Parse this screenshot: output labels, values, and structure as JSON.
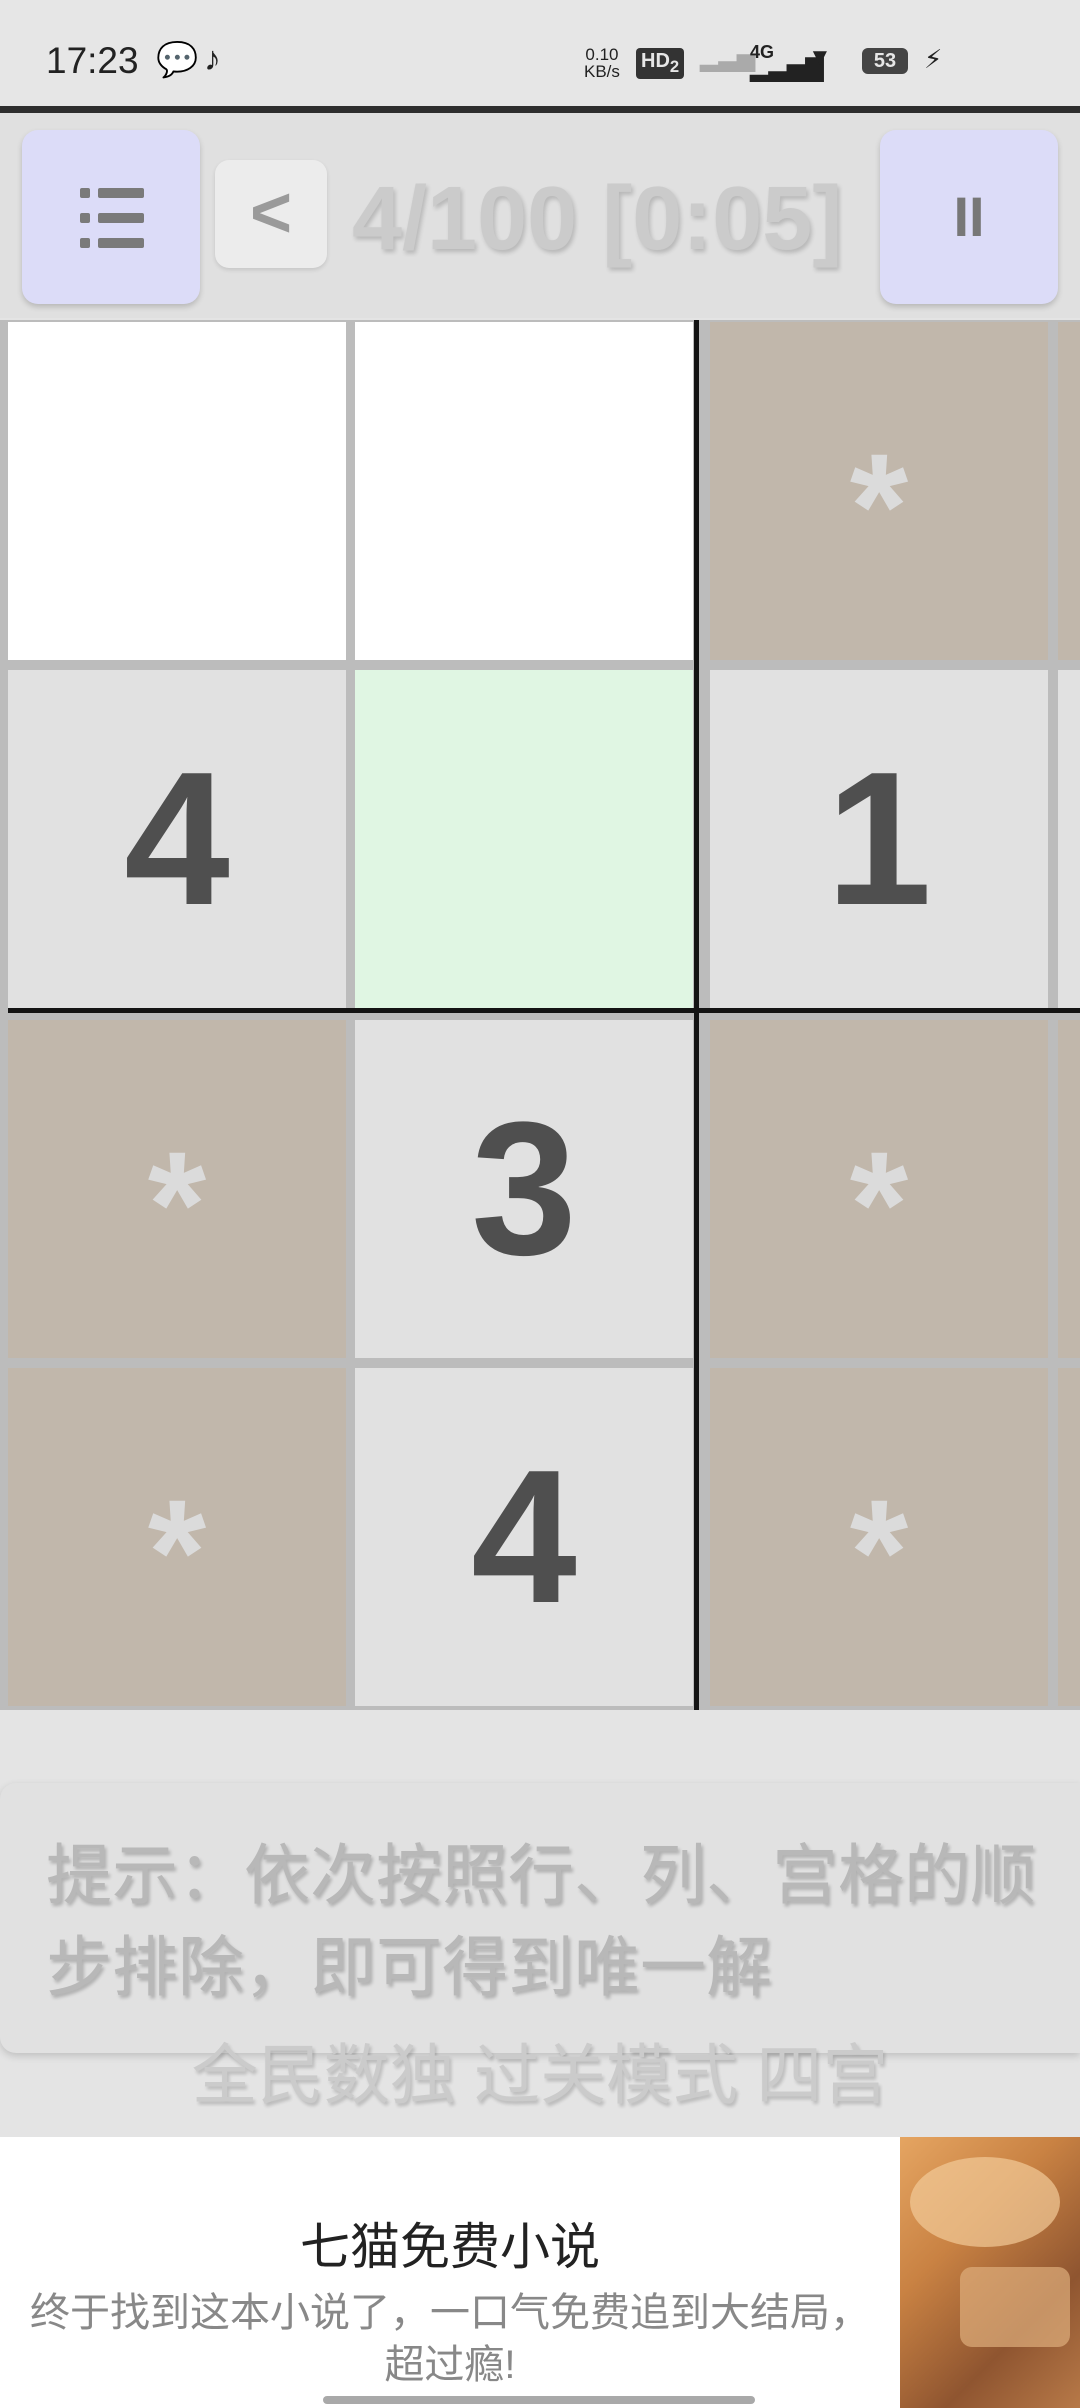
{
  "status_bar": {
    "time": "17:23",
    "net_speed_value": "0.10",
    "net_speed_unit": "KB/s",
    "hd_label": "HD",
    "hd_sub": "2",
    "network_type": "4G",
    "battery": "53"
  },
  "toolbar": {
    "back_label": "<",
    "level_display": "4/100 [0:05]",
    "pause_label": "II"
  },
  "board": {
    "rows": [
      [
        {
          "value": "",
          "style": "white"
        },
        {
          "value": "",
          "style": "white"
        },
        {
          "value": "*",
          "style": "tan"
        }
      ],
      [
        {
          "value": "4",
          "style": "gray"
        },
        {
          "value": "",
          "style": "green"
        },
        {
          "value": "1",
          "style": "gray"
        }
      ],
      [
        {
          "value": "*",
          "style": "tan"
        },
        {
          "value": "3",
          "style": "gray"
        },
        {
          "value": "*",
          "style": "tan"
        }
      ],
      [
        {
          "value": "*",
          "style": "tan"
        },
        {
          "value": "4",
          "style": "gray"
        },
        {
          "value": "*",
          "style": "tan"
        }
      ]
    ]
  },
  "hint": {
    "text": "提示：依次按照行、列、宫格的顺\n步排除，即可得到唯一解"
  },
  "mode_label": "全民数独 过关模式 四宫",
  "ad": {
    "title": "七猫免费小说",
    "description": "终于找到这本小说了，一口气免费追到大结局，超过瘾!"
  },
  "colors": {
    "given_cell": "#e1e1e1",
    "empty_cell": "#ffffff",
    "selected_cell": "#e0f6e3",
    "blocked_cell": "#c1b7ab",
    "button_bg": "#dcdcf8"
  }
}
